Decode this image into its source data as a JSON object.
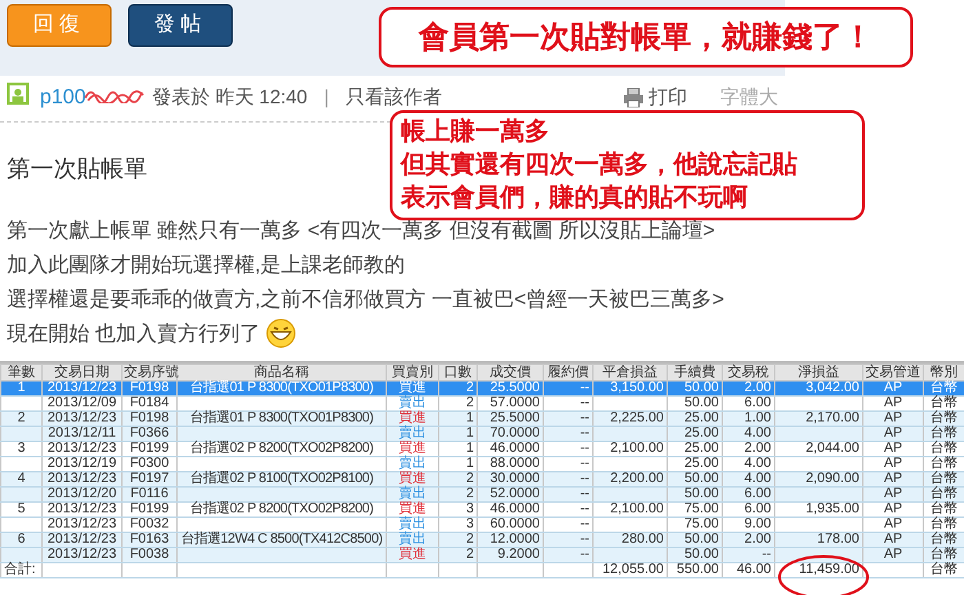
{
  "toolbar": {
    "buttons": [
      {
        "label": "回復",
        "kind": "reply"
      },
      {
        "label": "發帖",
        "kind": "post"
      }
    ]
  },
  "post": {
    "author": "p100",
    "meta": "發表於 昨天 12:40",
    "separator": "|",
    "author_only": "只看該作者",
    "print": "打印",
    "font_size": "字體大",
    "title": "第一次貼帳單",
    "body": [
      "第一次獻上帳單 雖然只有一萬多 <有四次一萬多 但沒有截圖 所以沒貼上論壇>",
      "加入此團隊才開始玩選擇權,是上課老師教的",
      "選擇權還是要乖乖的做賣方,之前不信邪做買方 一直被巴<曾經一天被巴三萬多>",
      "現在開始 也加入賣方行列了"
    ]
  },
  "table": {
    "columns": [
      "筆數",
      "交易日期",
      "交易序號",
      "商品名稱",
      "買賣別",
      "口數",
      "成交價",
      "履約價",
      "平倉損益",
      "手續費",
      "交易稅",
      "淨損益",
      "交易管道",
      "幣別"
    ],
    "rows": [
      {
        "kind": "trade",
        "selected": true,
        "cells": [
          "1",
          "2013/12/23",
          "F0198",
          "台指選01 P 8300(TXO01P8300)",
          "買進",
          "2",
          "25.5000",
          "--",
          "3,150.00",
          "50.00",
          "2.00",
          "3,042.00",
          "AP",
          "台幣"
        ]
      },
      {
        "kind": "trade",
        "selected": false,
        "shaded": false,
        "cells": [
          null,
          "2013/12/09",
          "F0184",
          null,
          {
            "text": "賣出",
            "color": "#2a8fe0"
          },
          "2",
          "57.0000",
          "--",
          null,
          "50.00",
          "6.00",
          null,
          "AP",
          "台幣"
        ]
      },
      {
        "kind": "trade",
        "selected": false,
        "shaded": true,
        "cells": [
          "2",
          "2013/12/23",
          "F0198",
          "台指選01 P 8300(TXO01P8300)",
          {
            "text": "買進",
            "color": "#e0303a"
          },
          "1",
          "25.5000",
          "--",
          "2,225.00",
          "25.00",
          "1.00",
          "2,170.00",
          "AP",
          "台幣"
        ]
      },
      {
        "kind": "trade",
        "selected": false,
        "shaded": true,
        "cells": [
          null,
          "2013/12/11",
          "F0366",
          null,
          {
            "text": "賣出",
            "color": "#2a8fe0"
          },
          "1",
          "70.0000",
          "--",
          null,
          "25.00",
          "4.00",
          null,
          "AP",
          "台幣"
        ]
      },
      {
        "kind": "trade",
        "selected": false,
        "shaded": false,
        "cells": [
          "3",
          "2013/12/23",
          "F0199",
          "台指選02 P 8200(TXO02P8200)",
          {
            "text": "買進",
            "color": "#e0303a"
          },
          "1",
          "46.0000",
          "--",
          "2,100.00",
          "25.00",
          "2.00",
          "2,044.00",
          "AP",
          "台幣"
        ]
      },
      {
        "kind": "trade",
        "selected": false,
        "shaded": false,
        "cells": [
          null,
          "2013/12/19",
          "F0300",
          null,
          {
            "text": "賣出",
            "color": "#2a8fe0"
          },
          "1",
          "88.0000",
          "--",
          null,
          "25.00",
          "4.00",
          null,
          "AP",
          "台幣"
        ]
      },
      {
        "kind": "trade",
        "selected": false,
        "shaded": true,
        "cells": [
          "4",
          "2013/12/23",
          "F0197",
          "台指選02 P 8100(TXO02P8100)",
          {
            "text": "買進",
            "color": "#e0303a"
          },
          "2",
          "30.0000",
          "--",
          "2,200.00",
          "50.00",
          "4.00",
          "2,090.00",
          "AP",
          "台幣"
        ]
      },
      {
        "kind": "trade",
        "selected": false,
        "shaded": true,
        "cells": [
          null,
          "2013/12/20",
          "F0116",
          null,
          {
            "text": "賣出",
            "color": "#2a8fe0"
          },
          "2",
          "52.0000",
          "--",
          null,
          "50.00",
          "6.00",
          null,
          "AP",
          "台幣"
        ]
      },
      {
        "kind": "trade",
        "selected": false,
        "shaded": false,
        "cells": [
          "5",
          "2013/12/23",
          "F0199",
          "台指選02 P 8200(TXO02P8200)",
          {
            "text": "買進",
            "color": "#e0303a"
          },
          "3",
          "46.0000",
          "--",
          "2,100.00",
          "75.00",
          "6.00",
          "1,935.00",
          "AP",
          "台幣"
        ]
      },
      {
        "kind": "trade",
        "selected": false,
        "shaded": false,
        "cells": [
          null,
          "2013/12/23",
          "F0032",
          null,
          {
            "text": "賣出",
            "color": "#2a8fe0"
          },
          "3",
          "60.0000",
          "--",
          null,
          "75.00",
          "9.00",
          null,
          "AP",
          "台幣"
        ]
      },
      {
        "kind": "trade",
        "selected": false,
        "shaded": true,
        "cells": [
          "6",
          "2013/12/23",
          "F0163",
          "台指選12W4 C 8500(TX412C8500)",
          {
            "text": "賣出",
            "color": "#2a8fe0"
          },
          "2",
          "12.0000",
          "--",
          "280.00",
          "50.00",
          "2.00",
          "178.00",
          "AP",
          "台幣"
        ]
      },
      {
        "kind": "trade",
        "selected": false,
        "shaded": true,
        "cells": [
          null,
          "2013/12/23",
          "F0038",
          null,
          {
            "text": "買進",
            "color": "#e0303a"
          },
          "2",
          "9.2000",
          "--",
          null,
          "50.00",
          "--",
          null,
          "AP",
          "台幣"
        ]
      },
      {
        "kind": "total",
        "selected": false,
        "shaded": false,
        "circled": true,
        "cells": [
          "合計:",
          null,
          null,
          null,
          null,
          null,
          null,
          null,
          "12,055.00",
          "550.00",
          "46.00",
          "11,459.00",
          null,
          "台幣"
        ]
      }
    ]
  },
  "annotations": [
    {
      "kind": "headline",
      "lines": [
        "會員第一次貼對帳單，就賺錢了！"
      ]
    },
    {
      "kind": "note",
      "lines": [
        "帳上賺一萬多",
        "但其實還有四次一萬多，他說忘記貼",
        "表示會員們，賺的真的貼不玩啊"
      ]
    }
  ]
}
